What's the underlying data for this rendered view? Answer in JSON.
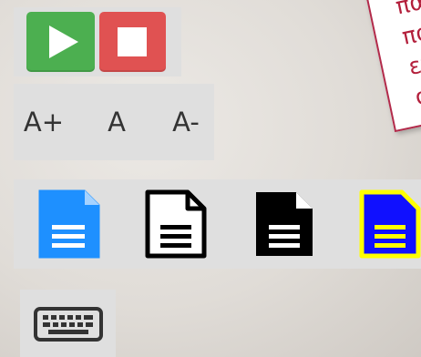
{
  "media_controls": {
    "play_icon": "play-icon",
    "stop_icon": "stop-icon",
    "play_color": "#4caf50",
    "stop_color": "#e05252"
  },
  "font_size_controls": {
    "increase_label": "A+",
    "normal_label": "A",
    "decrease_label": "A-"
  },
  "contrast_themes": [
    {
      "name": "blue-white",
      "icon": "document-icon",
      "page": "#1e90ff",
      "lines": "#ffffff"
    },
    {
      "name": "white-black",
      "icon": "document-icon",
      "page": "#ffffff",
      "lines": "#000000"
    },
    {
      "name": "black-white",
      "icon": "document-icon",
      "page": "#000000",
      "lines": "#ffffff"
    },
    {
      "name": "blue-yellow",
      "icon": "document-icon",
      "page": "#1010ff",
      "lines": "#ffff00"
    }
  ],
  "keyboard": {
    "icon": "keyboard-icon"
  },
  "note": {
    "lines": [
      "πα",
      "πα",
      "επ",
      "σα"
    ],
    "border_color": "#b22a4a",
    "text_color": "#b31f3b"
  }
}
